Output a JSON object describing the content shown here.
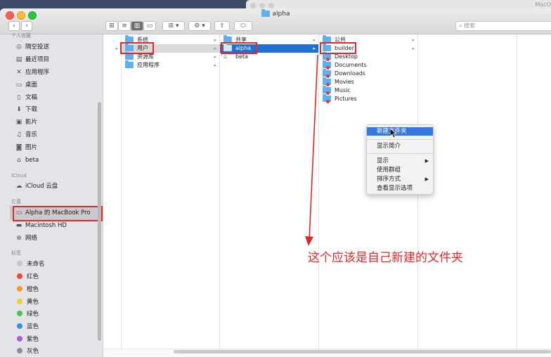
{
  "window": {
    "title": "alpha",
    "bg_window_title": "MacO"
  },
  "toolbar": {
    "back": "‹",
    "forward": "›",
    "view_icons": [
      "icon-view-icon",
      "list-view-icon",
      "column-view-icon",
      "gallery-view-icon"
    ],
    "group_label": "▾",
    "action_label": "▾",
    "search_placeholder": "搜索"
  },
  "sidebar": {
    "section_favorites_partial": "个人收藏",
    "favorites": [
      {
        "label": "隔空投送",
        "icon": "airdrop-icon"
      },
      {
        "label": "最近项目",
        "icon": "recents-icon"
      },
      {
        "label": "应用程序",
        "icon": "applications-icon"
      },
      {
        "label": "桌面",
        "icon": "desktop-icon"
      },
      {
        "label": "文稿",
        "icon": "documents-icon"
      },
      {
        "label": "下载",
        "icon": "downloads-icon"
      },
      {
        "label": "影片",
        "icon": "movies-icon"
      },
      {
        "label": "音乐",
        "icon": "music-icon"
      },
      {
        "label": "图片",
        "icon": "pictures-icon"
      },
      {
        "label": "beta",
        "icon": "home-icon"
      }
    ],
    "section_icloud": "iCloud",
    "icloud": [
      {
        "label": "iCloud 云盘",
        "icon": "cloud-icon"
      }
    ],
    "section_locations": "位置",
    "locations": [
      {
        "label": "Alpha 的 MacBook Pro",
        "icon": "laptop-icon"
      },
      {
        "label": "Macintosh HD",
        "icon": "disk-icon"
      },
      {
        "label": "网络",
        "icon": "network-icon"
      }
    ],
    "section_tags": "标签",
    "tags": [
      {
        "label": "未命名",
        "color": "#c7c7c7"
      },
      {
        "label": "红色",
        "color": "#f0463c"
      },
      {
        "label": "橙色",
        "color": "#f59b2c"
      },
      {
        "label": "黄色",
        "color": "#f3cf2e"
      },
      {
        "label": "绿色",
        "color": "#4bc547"
      },
      {
        "label": "蓝色",
        "color": "#3a8ef0"
      },
      {
        "label": "紫色",
        "color": "#a760d6"
      },
      {
        "label": "灰色",
        "color": "#8e8e93"
      }
    ]
  },
  "columns": {
    "col0": [
      {
        "label": "",
        "arrow": "▸"
      }
    ],
    "col1": [
      {
        "label": "系统"
      },
      {
        "label": "用户",
        "selected": "grey"
      },
      {
        "label": "资源库"
      },
      {
        "label": "应用程序"
      }
    ],
    "col2": [
      {
        "label": "共享"
      },
      {
        "label": "alpha",
        "selected": "blue"
      },
      {
        "label": "beta",
        "icon": "home-icon"
      }
    ],
    "col3": [
      {
        "label": "公共"
      },
      {
        "label": "builder",
        "selected": "none"
      },
      {
        "label": "Desktop"
      },
      {
        "label": "Documents"
      },
      {
        "label": "Downloads"
      },
      {
        "label": "Movies"
      },
      {
        "label": "Music"
      },
      {
        "label": "Pictures"
      }
    ]
  },
  "context_menu": {
    "items": [
      {
        "label": "新建文件夹",
        "highlighted": true
      },
      {
        "label": "显示简介"
      },
      {
        "label": "显示",
        "submenu": true
      },
      {
        "label": "使用群组"
      },
      {
        "label": "排序方式",
        "submenu": true
      },
      {
        "label": "查看显示选项"
      }
    ]
  },
  "annotation": {
    "text": "这个应该是自己新建的文件夹",
    "color": "#e02828"
  }
}
